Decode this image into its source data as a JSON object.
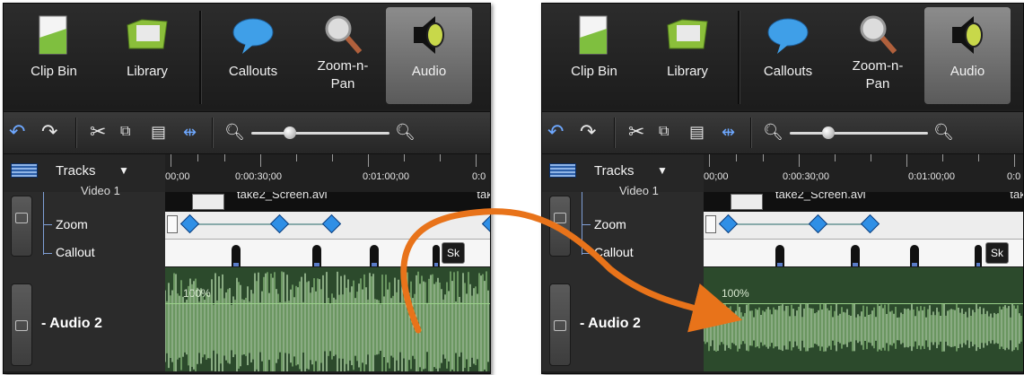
{
  "before": {
    "tabs": [
      {
        "label": "Clip Bin",
        "icon": "clip-bin-icon"
      },
      {
        "label": "Library",
        "icon": "library-folder-icon"
      },
      {
        "label": "Callouts",
        "icon": "speech-bubble-icon"
      },
      {
        "label": "Zoom-n-Pan",
        "line1": "Zoom-n-",
        "line2": "Pan",
        "icon": "magnifier-icon"
      },
      {
        "label": "Audio",
        "icon": "speaker-icon",
        "active": true
      }
    ],
    "tracks_label": "Tracks",
    "ruler_labels": [
      "00;00",
      "0:00:30;00",
      "0:01:00;00",
      "0:0"
    ],
    "video_track_partial": "Video 1",
    "clip_name": "take2_Screen.avi",
    "clip_name_partial": "take",
    "subtracks": [
      "Zoom",
      "Callout"
    ],
    "audio_track": "- Audio 2",
    "volume_label": "100%",
    "callout_box": "Sk"
  },
  "after": {
    "tabs": [
      {
        "label": "Clip Bin",
        "icon": "clip-bin-icon"
      },
      {
        "label": "Library",
        "icon": "library-folder-icon"
      },
      {
        "label": "Callouts",
        "icon": "speech-bubble-icon"
      },
      {
        "label": "Zoom-n-Pan",
        "line1": "Zoom-n-",
        "line2": "Pan",
        "icon": "magnifier-icon"
      },
      {
        "label": "Audio",
        "icon": "speaker-icon",
        "active": true
      }
    ],
    "tracks_label": "Tracks",
    "ruler_labels": [
      "00;00",
      "0:00:30;00",
      "0:01:00;00",
      "0:0"
    ],
    "video_track_partial": "Video 1",
    "clip_name": "take2_Screen.avi",
    "clip_name_partial": "take",
    "subtracks": [
      "Zoom",
      "Callout"
    ],
    "audio_track": "- Audio 2",
    "volume_label": "100%",
    "callout_box": "Sk"
  },
  "colors": {
    "arrow": "#e8731a",
    "active_tab": "#7a7a7a",
    "audio_wave": "#a7d69a",
    "keyframe": "#2f8fe6"
  }
}
